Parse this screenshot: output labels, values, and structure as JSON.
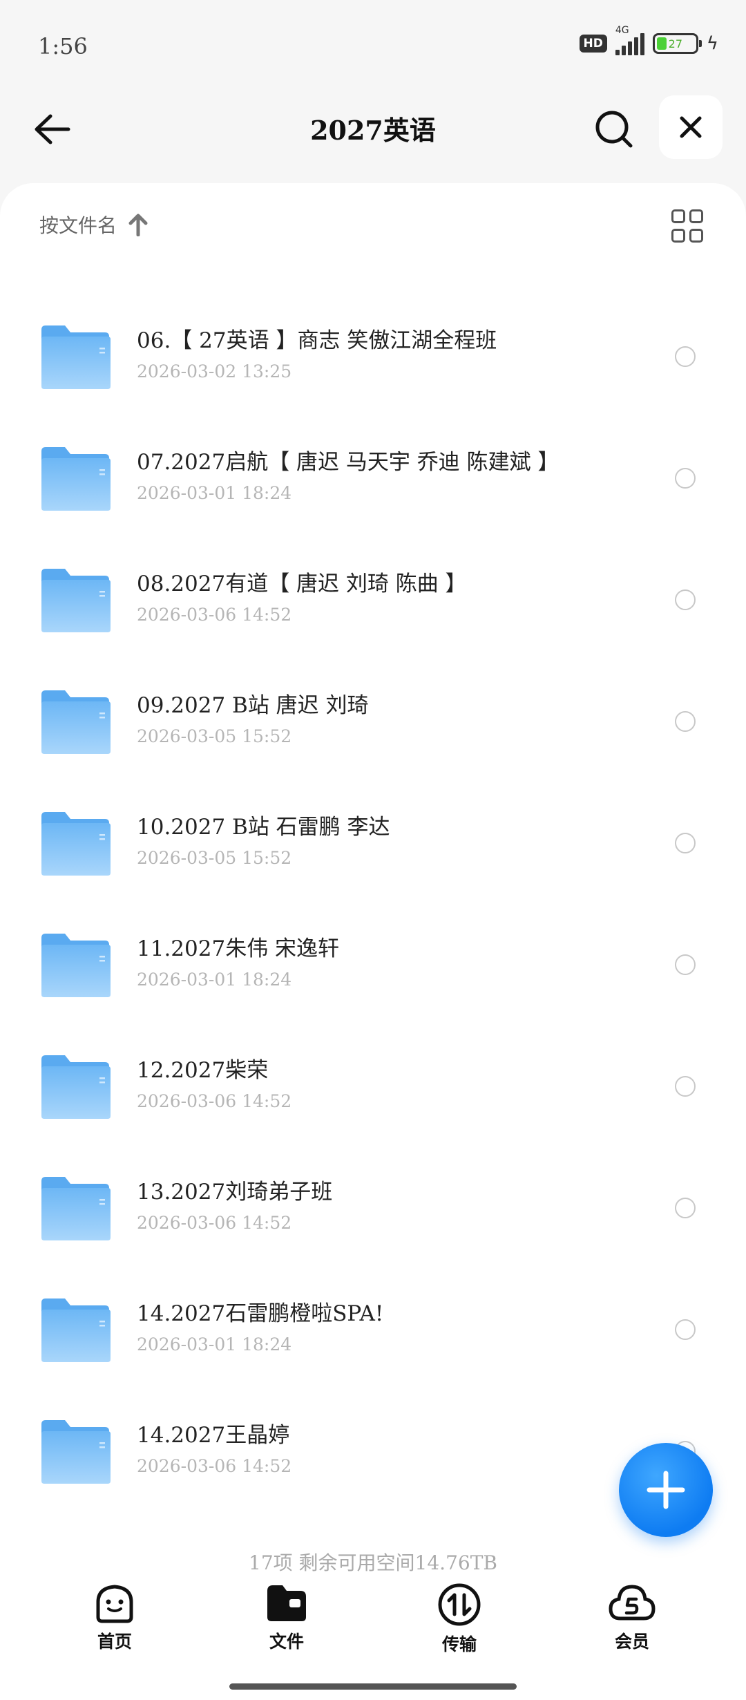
{
  "status_bar": {
    "time": "1:56",
    "hd": "HD",
    "network": "4G",
    "battery_level": "27"
  },
  "header": {
    "title": "2027英语"
  },
  "sort": {
    "label": "按文件名"
  },
  "files": [
    {
      "name": "06.【 27英语 】商志 笑傲江湖全程班",
      "date": "2026-03-02 13:25"
    },
    {
      "name": "07.2027启航【 唐迟 马天宇 乔迪 陈建斌 】",
      "date": "2026-03-01 18:24"
    },
    {
      "name": "08.2027有道【 唐迟 刘琦 陈曲 】",
      "date": "2026-03-06 14:52"
    },
    {
      "name": "09.2027 B站 唐迟 刘琦",
      "date": "2026-03-05 15:52"
    },
    {
      "name": "10.2027 B站 石雷鹏 李达",
      "date": "2026-03-05 15:52"
    },
    {
      "name": "11.2027朱伟 宋逸轩",
      "date": "2026-03-01 18:24"
    },
    {
      "name": "12.2027柴荣",
      "date": "2026-03-06 14:52"
    },
    {
      "name": "13.2027刘琦弟子班",
      "date": "2026-03-06 14:52"
    },
    {
      "name": "14.2027石雷鹏橙啦SPA!",
      "date": "2026-03-01 18:24"
    },
    {
      "name": "14.2027王晶婷",
      "date": "2026-03-06 14:52"
    }
  ],
  "footer": {
    "summary": "17项 剩余可用空间14.76TB"
  },
  "nav": {
    "home": "首页",
    "files": "文件",
    "transfer": "传输",
    "vip": "会员"
  },
  "colors": {
    "accent": "#0e7cf2",
    "folder": "#7cc1f7",
    "battery": "#4cd137"
  }
}
